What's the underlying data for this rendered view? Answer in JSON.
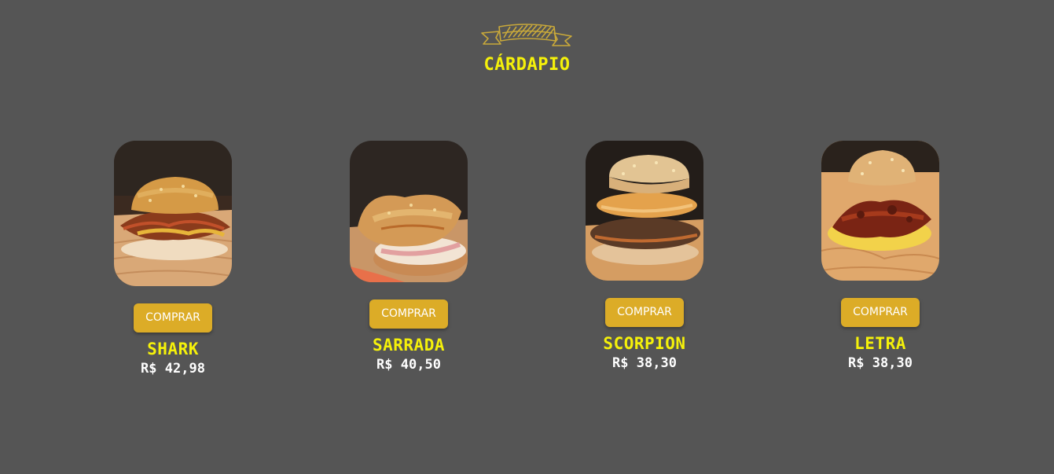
{
  "header": {
    "title": "CÁRDAPIO"
  },
  "colors": {
    "background": "#555555",
    "accent_yellow": "#f5f10a",
    "button": "#dcac27"
  },
  "menu": {
    "items": [
      {
        "name": "SHARK",
        "price": "R$ 42,98",
        "button_label": "COMPRAR",
        "image": "burger-shark-photo"
      },
      {
        "name": "SARRADA",
        "price": "R$ 40,50",
        "button_label": "COMPRAR",
        "image": "burger-sarrada-photo"
      },
      {
        "name": "SCORPION",
        "price": "R$ 38,30",
        "button_label": "COMPRAR",
        "image": "burger-scorpion-photo"
      },
      {
        "name": "LETRA",
        "price": "R$ 38,30",
        "button_label": "COMPRAR",
        "image": "burger-letra-photo"
      }
    ]
  }
}
